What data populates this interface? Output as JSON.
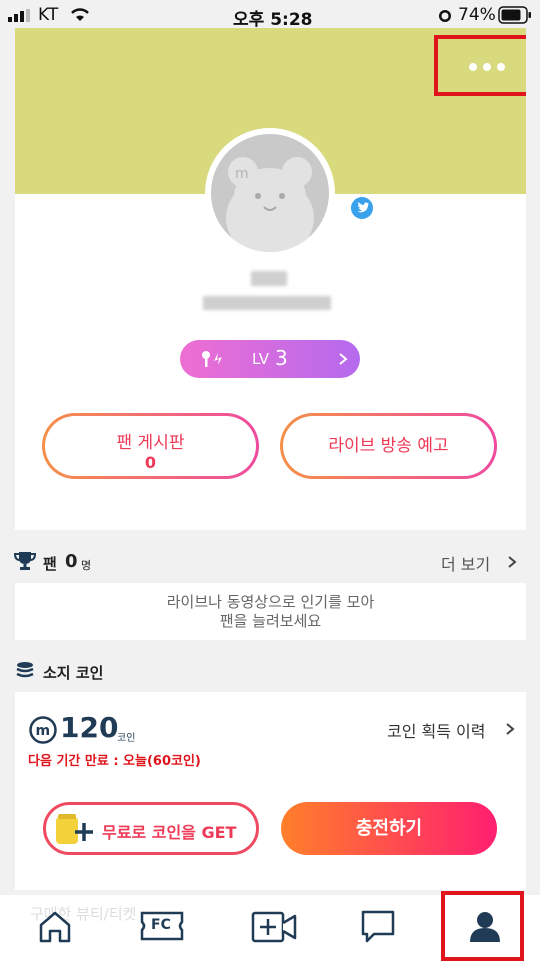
{
  "status_bar": {
    "carrier": "KT",
    "time": "오후 5:28",
    "battery": "74%"
  },
  "profile": {
    "more_icon": "ellipsis-icon",
    "level_prefix": "LV",
    "level_value": "3",
    "fan_board_label": "팬 게시판",
    "fan_board_count": "0",
    "live_notice_label": "라이브 방송 예고"
  },
  "fans": {
    "title": "팬",
    "count": "0",
    "unit": "명",
    "more_label": "더 보기",
    "empty_message_line1": "라이브나 동영상으로 인기를 모아",
    "empty_message_line2": "팬을 늘려보세요"
  },
  "coins": {
    "title": "소지 코인",
    "amount": "120",
    "unit": "코인",
    "history_label": "코인 획득 이력",
    "expiry_notice": "다음 기간 만료 : 오늘(60코인)",
    "free_coin_label": "무료로 코인을 GET",
    "charge_label": "충전하기"
  },
  "partially_hidden": {
    "text": "구매한 뷰티/티켓"
  },
  "bottom_nav": {
    "items": [
      {
        "icon": "home-icon"
      },
      {
        "icon": "fc-ticket-icon",
        "label": "FC"
      },
      {
        "icon": "video-add-icon"
      },
      {
        "icon": "chat-icon"
      },
      {
        "icon": "profile-icon"
      }
    ]
  },
  "colors": {
    "banner": "#d9da7e",
    "accent_pink": "#ef4a60",
    "highlight_red": "#e0141b",
    "navy": "#1f3b55"
  }
}
